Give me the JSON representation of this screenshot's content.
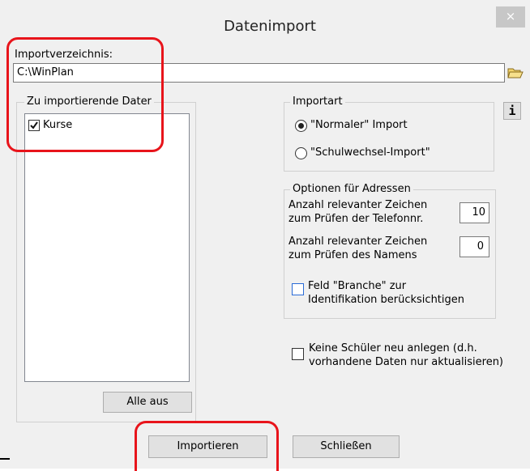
{
  "window": {
    "title": "Datenimport",
    "close_label": "×"
  },
  "import_dir": {
    "label": "Importverzeichnis:",
    "value": "C:\\WinPlan"
  },
  "files_group": {
    "legend": "Zu importierende Dater",
    "items": [
      {
        "label": "Kurse",
        "checked": true
      }
    ],
    "deselect_all_label": "Alle aus"
  },
  "import_type": {
    "legend": "Importart",
    "options": [
      {
        "label": "\"Normaler\" Import",
        "selected": true
      },
      {
        "label": "\"Schulwechsel-Import\"",
        "selected": false
      }
    ]
  },
  "info_button_label": "i",
  "address_options": {
    "legend": "Optionen für Adressen",
    "phone_chars_label_1": "Anzahl relevanter Zeichen",
    "phone_chars_label_2": "zum Prüfen der Telefonnr.",
    "phone_chars_value": "10",
    "name_chars_label_1": "Anzahl relevanter Zeichen",
    "name_chars_label_2": "zum Prüfen des Namens",
    "name_chars_value": "0",
    "branche_label_1": "Feld \"Branche\" zur",
    "branche_label_2": "Identifikation berücksichtigen",
    "branche_checked": false
  },
  "no_new_students": {
    "label_1": "Keine Schüler neu anlegen (d.h.",
    "label_2": "vorhandene Daten nur aktualisieren)",
    "checked": false
  },
  "footer": {
    "import_label": "Importieren",
    "close_label": "Schließen"
  },
  "colors": {
    "highlight": "#e8141b",
    "checkbox_accent": "#2a6bd6"
  }
}
